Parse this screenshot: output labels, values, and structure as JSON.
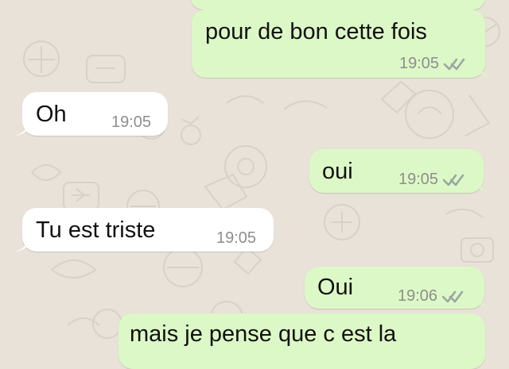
{
  "chat": {
    "messages": [
      {
        "id": "m1",
        "direction": "out",
        "text": "pour de bon cette fois",
        "time": "19:05",
        "status_icon": "double-check-icon"
      },
      {
        "id": "m2",
        "direction": "in",
        "text": "Oh",
        "time": "19:05"
      },
      {
        "id": "m3",
        "direction": "out",
        "text": "oui",
        "time": "19:05",
        "status_icon": "double-check-icon"
      },
      {
        "id": "m4",
        "direction": "in",
        "text": "Tu est triste",
        "time": "19:05"
      },
      {
        "id": "m5",
        "direction": "out",
        "text": "Oui",
        "time": "19:06",
        "status_icon": "double-check-icon"
      },
      {
        "id": "m6",
        "direction": "out",
        "text": "mais je pense que c est la"
      }
    ]
  },
  "theme": {
    "outgoing_bubble": "#dcf8c6",
    "incoming_bubble": "#ffffff",
    "background": "#e8e2d8",
    "timestamp": "#8e8e8e",
    "checks": "#9aa7a1"
  }
}
